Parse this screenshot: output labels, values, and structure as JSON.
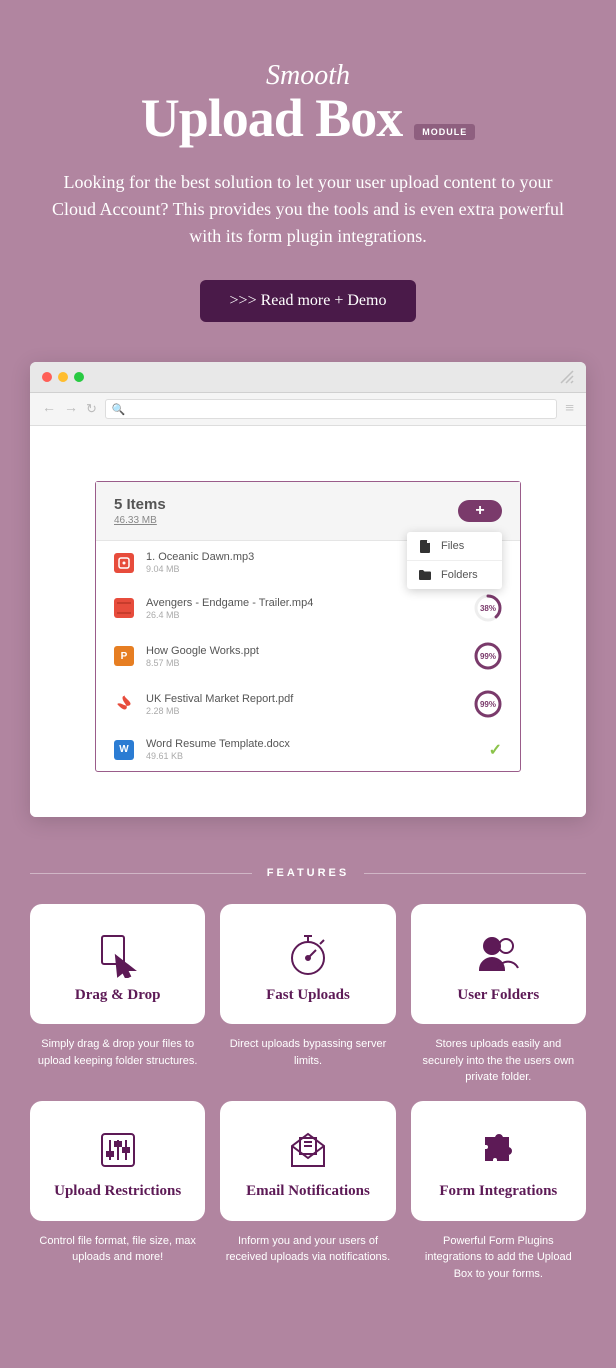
{
  "header": {
    "pretitle": "Smooth",
    "title": "Upload Box",
    "badge": "MODULE",
    "subtitle": "Looking for the best solution to let your user upload content to your Cloud Account? This provides you the tools and is even extra powerful with its form plugin integrations.",
    "cta": ">>> Read more + Demo"
  },
  "widget": {
    "count_label": "5 Items",
    "total_size": "46.33 MB",
    "dropdown": {
      "files": "Files",
      "folders": "Folders"
    },
    "files": [
      {
        "name": "1. Oceanic Dawn.mp3",
        "size": "9.04 MB",
        "type": "mp3",
        "progress": null,
        "done": false
      },
      {
        "name": "Avengers - Endgame - Trailer.mp4",
        "size": "26.4 MB",
        "type": "mp4",
        "progress": 38,
        "done": false
      },
      {
        "name": "How Google Works.ppt",
        "size": "8.57 MB",
        "type": "ppt",
        "progress": 99,
        "done": false
      },
      {
        "name": "UK Festival Market Report.pdf",
        "size": "2.28 MB",
        "type": "pdf",
        "progress": 99,
        "done": false
      },
      {
        "name": "Word Resume Template.docx",
        "size": "49.61 KB",
        "type": "docx",
        "progress": null,
        "done": true
      }
    ]
  },
  "features_label": "FEATURES",
  "features": [
    {
      "title": "Drag & Drop",
      "desc": "Simply drag & drop your files to upload keeping folder structures.",
      "icon": "drag-drop"
    },
    {
      "title": "Fast Uploads",
      "desc": "Direct uploads bypassing server limits.",
      "icon": "stopwatch"
    },
    {
      "title": "User Folders",
      "desc": "Stores uploads easily and securely into the the users own private folder.",
      "icon": "users"
    },
    {
      "title": "Upload Restrictions",
      "desc": "Control file format, file size, max uploads and more!",
      "icon": "sliders"
    },
    {
      "title": "Email Notifications",
      "desc": "Inform you and your users of received uploads via notifications.",
      "icon": "mail"
    },
    {
      "title": "Form Integrations",
      "desc": "Powerful Form Plugins integrations to add the Upload Box to your forms.",
      "icon": "puzzle"
    }
  ]
}
